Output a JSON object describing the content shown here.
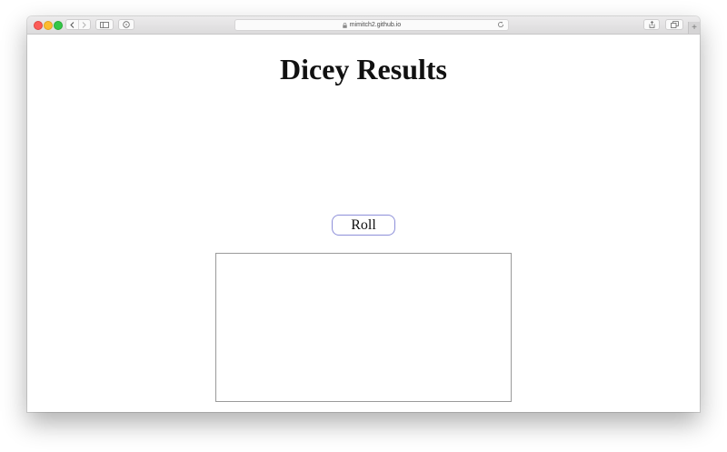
{
  "browser": {
    "url": "mimitch2.github.io"
  },
  "page": {
    "title": "Dicey Results",
    "roll_label": "Roll"
  },
  "colors": {
    "button_border": "#8d8fd9",
    "results_border": "#9a9a9a"
  }
}
